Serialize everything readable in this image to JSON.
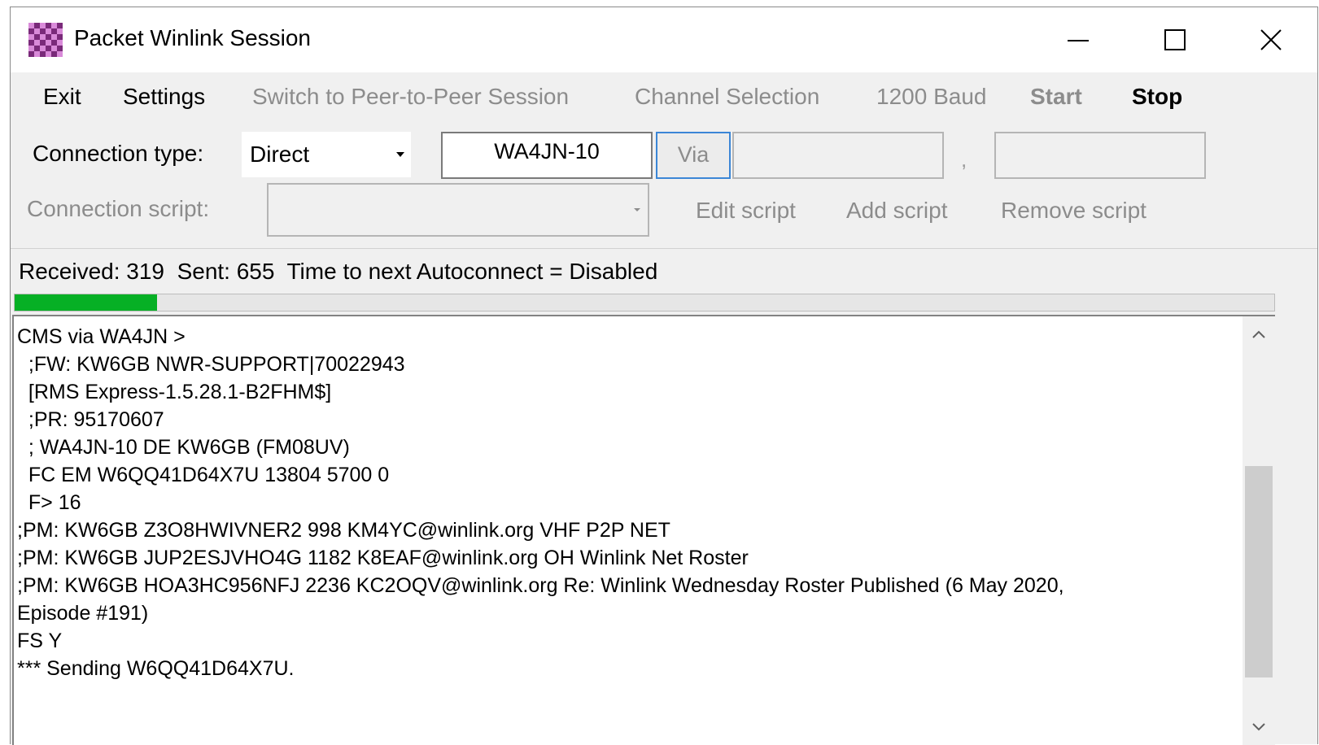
{
  "window": {
    "title": "Packet Winlink Session"
  },
  "menu": {
    "exit": "Exit",
    "settings": "Settings",
    "switch_p2p": "Switch to Peer-to-Peer Session",
    "channel_selection": "Channel Selection",
    "baud": "1200 Baud",
    "start": "Start",
    "stop": "Stop"
  },
  "connection": {
    "type_label": "Connection type:",
    "type_value": "Direct",
    "target": "WA4JN-10",
    "via_label": "Via",
    "via_field_1": "",
    "via_separator": ",",
    "via_field_2": ""
  },
  "script": {
    "label": "Connection script:",
    "selected": "",
    "edit": "Edit script",
    "add": "Add script",
    "remove": "Remove script"
  },
  "status": {
    "text": "Received: 319  Sent: 655  Time to next Autoconnect = Disabled",
    "progress_fraction": 0.113
  },
  "log": {
    "lines": [
      "CMS via WA4JN >",
      "  ;FW: KW6GB NWR-SUPPORT|70022943",
      "  [RMS Express-1.5.28.1-B2FHM$]",
      "  ;PR: 95170607",
      "  ; WA4JN-10 DE KW6GB (FM08UV)",
      "  FC EM W6QQ41D64X7U 13804 5700 0",
      "  F> 16",
      ";PM: KW6GB Z3O8HWIVNER2 998 KM4YC@winlink.org VHF P2P NET",
      ";PM: KW6GB JUP2ESJVHO4G 1182 K8EAF@winlink.org OH Winlink Net Roster",
      ";PM: KW6GB HOA3HC956NFJ 2236 KC2OQV@winlink.org Re: Winlink Wednesday Roster Published (6 May 2020,",
      "Episode #191)",
      "FS Y",
      "*** Sending W6QQ41D64X7U."
    ],
    "scroll_position": 0.78
  },
  "colors": {
    "progress": "#06b025",
    "focus_border": "#3b86d6",
    "disabled_text": "#8c8c8c"
  }
}
